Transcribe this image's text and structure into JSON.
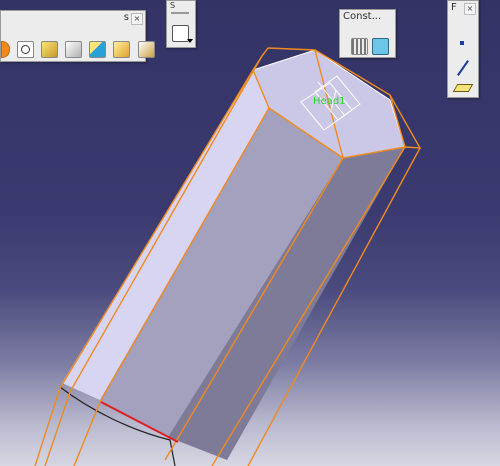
{
  "toolbars": {
    "tools": {
      "title": "s",
      "close": "×",
      "icons": [
        "bool-op-icon",
        "pocket-icon",
        "shaft-icon",
        "rib-icon",
        "solid-cube-icon",
        "chamfer-icon",
        "fillet-icon"
      ]
    },
    "sketch": {
      "title": "S",
      "icons": [
        "sketch-icon"
      ]
    },
    "constraints": {
      "title": "Const...",
      "close": "×",
      "icons": [
        "constraint-bars-icon",
        "fix-constraint-icon"
      ]
    },
    "geometry": {
      "title": "F",
      "close": "×",
      "icons": [
        "point-icon",
        "line-icon",
        "plane-icon"
      ]
    }
  },
  "viewport": {
    "axis_label": "Head1"
  },
  "colors": {
    "background_top": "#333366",
    "background_bottom": "#d6d6e2",
    "highlight_edges": "#f08a1e",
    "selected_edge": "#e02020",
    "axis_label": "#22dd22",
    "face_light": "#d7d5f2",
    "face_mid": "#a3a1bd",
    "face_dark": "#7d7b97"
  }
}
